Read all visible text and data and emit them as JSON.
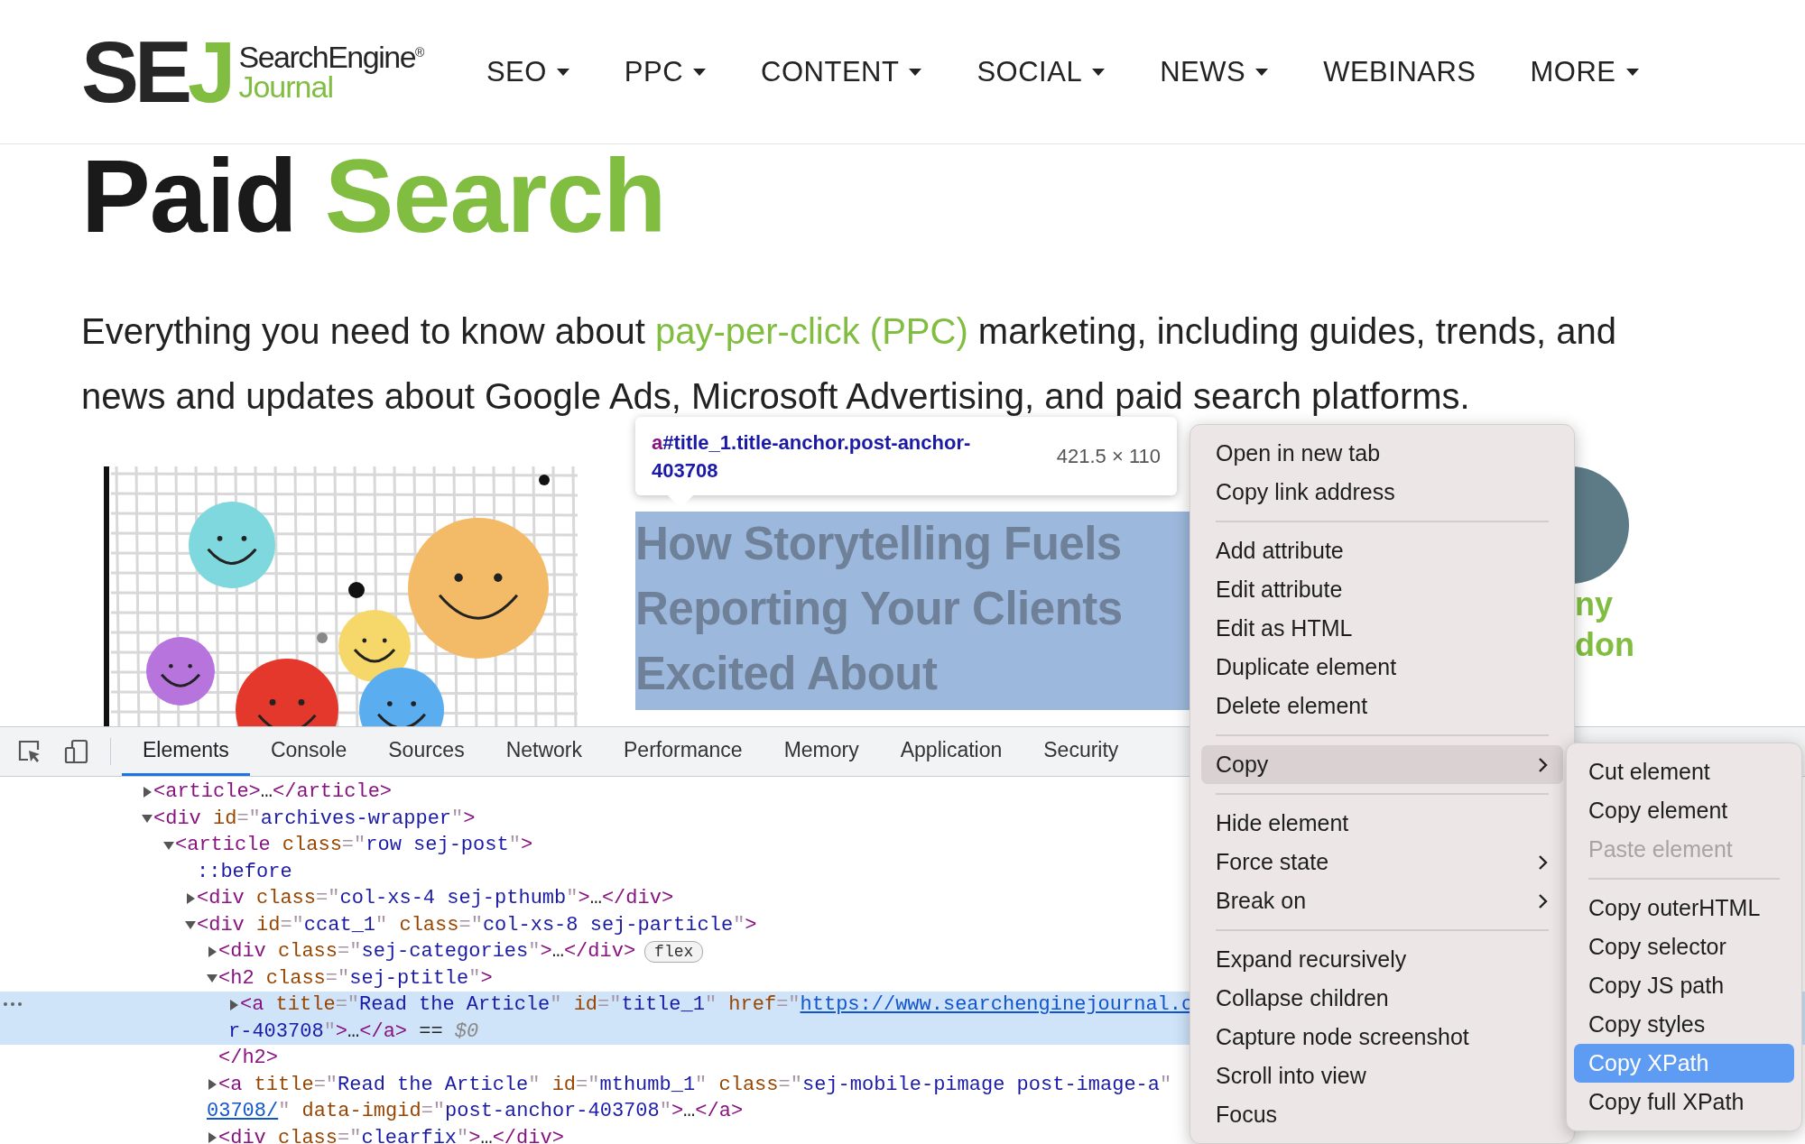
{
  "header": {
    "logo": {
      "mark": "SE",
      "mark_accent": "J",
      "wordmark": "SearchEngine$^{®}$",
      "wordmark_accent": "Journal"
    },
    "nav": [
      {
        "label": "SEO",
        "dropdown": true
      },
      {
        "label": "PPC",
        "dropdown": true
      },
      {
        "label": "CONTENT",
        "dropdown": true
      },
      {
        "label": "SOCIAL",
        "dropdown": true
      },
      {
        "label": "NEWS",
        "dropdown": true
      },
      {
        "label": "WEBINARS",
        "dropdown": false
      },
      {
        "label": "MORE",
        "dropdown": true
      }
    ]
  },
  "hero": {
    "title": "Paid",
    "title_accent": "Search",
    "intro_before": "Everything you need to know about ",
    "intro_link": "pay-per-click (PPC)",
    "intro_after": " marketing, including guides, trends, and news and updates about Google Ads, Microsoft Advertising, and paid search platforms."
  },
  "inspect_tooltip": {
    "tag": "a",
    "selector": "#title_1.title-anchor.post-anchor-403708",
    "size": "421.5 × 110"
  },
  "article": {
    "title_lines": [
      "How Storytelling Fuels",
      "Reporting Your Clients",
      "Excited About"
    ],
    "author_lines": [
      "ny",
      "don"
    ]
  },
  "devtools": {
    "tabs": [
      {
        "label": "Elements",
        "selected": true
      },
      {
        "label": "Console",
        "selected": false
      },
      {
        "label": "Sources",
        "selected": false
      },
      {
        "label": "Network",
        "selected": false
      },
      {
        "label": "Performance",
        "selected": false
      },
      {
        "label": "Memory",
        "selected": false
      },
      {
        "label": "Application",
        "selected": false
      },
      {
        "label": "Security",
        "selected": false
      }
    ],
    "tree": [
      {
        "kind": "element",
        "expanded": false,
        "selected": false,
        "lines": [
          [
            {
              "kind": "tag",
              "text": "<article>"
            },
            {
              "kind": "text",
              "text": "…"
            },
            {
              "kind": "tag",
              "text": "</article>"
            }
          ]
        ]
      },
      {
        "kind": "element",
        "expanded": true,
        "selected": false,
        "lines": [
          [
            {
              "kind": "tag",
              "text": "<div"
            },
            {
              "kind": "attr",
              "text": " id"
            },
            {
              "kind": "punct",
              "text": "=\""
            },
            {
              "kind": "value",
              "text": "archives-wrapper"
            },
            {
              "kind": "punct",
              "text": "\""
            },
            {
              "kind": "tag",
              "text": ">"
            }
          ]
        ],
        "children": [
          {
            "kind": "element",
            "expanded": true,
            "selected": false,
            "lines": [
              [
                {
                  "kind": "tag",
                  "text": "<article"
                },
                {
                  "kind": "attr",
                  "text": " class"
                },
                {
                  "kind": "punct",
                  "text": "=\""
                },
                {
                  "kind": "value",
                  "text": "row sej-post"
                },
                {
                  "kind": "punct",
                  "text": "\""
                },
                {
                  "kind": "tag",
                  "text": ">"
                }
              ]
            ],
            "children": [
              {
                "kind": "pseudo",
                "selected": false,
                "lines": [
                  [
                    {
                      "kind": "pseudo",
                      "text": "::before"
                    }
                  ]
                ]
              },
              {
                "kind": "element",
                "expanded": false,
                "selected": false,
                "lines": [
                  [
                    {
                      "kind": "tag",
                      "text": "<div"
                    },
                    {
                      "kind": "attr",
                      "text": " class"
                    },
                    {
                      "kind": "punct",
                      "text": "=\""
                    },
                    {
                      "kind": "value",
                      "text": "col-xs-4 sej-pthumb"
                    },
                    {
                      "kind": "punct",
                      "text": "\""
                    },
                    {
                      "kind": "tag",
                      "text": ">"
                    },
                    {
                      "kind": "text",
                      "text": "…"
                    },
                    {
                      "kind": "tag",
                      "text": "</div>"
                    }
                  ]
                ]
              },
              {
                "kind": "element",
                "expanded": true,
                "selected": false,
                "lines": [
                  [
                    {
                      "kind": "tag",
                      "text": "<div"
                    },
                    {
                      "kind": "attr",
                      "text": " id"
                    },
                    {
                      "kind": "punct",
                      "text": "=\""
                    },
                    {
                      "kind": "value",
                      "text": "ccat_1"
                    },
                    {
                      "kind": "punct",
                      "text": "\""
                    },
                    {
                      "kind": "attr",
                      "text": " class"
                    },
                    {
                      "kind": "punct",
                      "text": "=\""
                    },
                    {
                      "kind": "value",
                      "text": "col-xs-8 sej-particle"
                    },
                    {
                      "kind": "punct",
                      "text": "\""
                    },
                    {
                      "kind": "tag",
                      "text": ">"
                    }
                  ]
                ],
                "children": [
                  {
                    "kind": "element",
                    "expanded": false,
                    "selected": false,
                    "lines": [
                      [
                        {
                          "kind": "tag",
                          "text": "<div"
                        },
                        {
                          "kind": "attr",
                          "text": " class"
                        },
                        {
                          "kind": "punct",
                          "text": "=\""
                        },
                        {
                          "kind": "value",
                          "text": "sej-categories"
                        },
                        {
                          "kind": "punct",
                          "text": "\""
                        },
                        {
                          "kind": "tag",
                          "text": ">"
                        },
                        {
                          "kind": "text",
                          "text": "…"
                        },
                        {
                          "kind": "tag",
                          "text": "</div>"
                        },
                        {
                          "kind": "badge",
                          "text": "flex"
                        }
                      ]
                    ]
                  },
                  {
                    "kind": "element",
                    "expanded": true,
                    "selected": false,
                    "lines": [
                      [
                        {
                          "kind": "tag",
                          "text": "<h2"
                        },
                        {
                          "kind": "attr",
                          "text": " class"
                        },
                        {
                          "kind": "punct",
                          "text": "=\""
                        },
                        {
                          "kind": "value",
                          "text": "sej-ptitle"
                        },
                        {
                          "kind": "punct",
                          "text": "\""
                        },
                        {
                          "kind": "tag",
                          "text": ">"
                        }
                      ]
                    ],
                    "closing": [
                      {
                        "kind": "tag",
                        "text": "</h2>"
                      }
                    ],
                    "children": [
                      {
                        "kind": "element",
                        "expanded": false,
                        "selected": true,
                        "lines": [
                          [
                            {
                              "kind": "tag",
                              "text": "<a"
                            },
                            {
                              "kind": "attr",
                              "text": " title"
                            },
                            {
                              "kind": "punct",
                              "text": "=\""
                            },
                            {
                              "kind": "value",
                              "text": "Read the Article"
                            },
                            {
                              "kind": "punct",
                              "text": "\""
                            },
                            {
                              "kind": "attr",
                              "text": " id"
                            },
                            {
                              "kind": "punct",
                              "text": "=\""
                            },
                            {
                              "kind": "value",
                              "text": "title_1"
                            },
                            {
                              "kind": "punct",
                              "text": "\""
                            },
                            {
                              "kind": "attr",
                              "text": " href"
                            },
                            {
                              "kind": "punct",
                              "text": "=\""
                            },
                            {
                              "kind": "link",
                              "text": "https://www.searchenginejournal.c"
                            }
                          ],
                          [
                            {
                              "kind": "value",
                              "text": "r-403708"
                            },
                            {
                              "kind": "punct",
                              "text": "\""
                            },
                            {
                              "kind": "tag",
                              "text": ">"
                            },
                            {
                              "kind": "text",
                              "text": "…"
                            },
                            {
                              "kind": "tag",
                              "text": "</a>"
                            },
                            {
                              "kind": "text",
                              "text": " == "
                            },
                            {
                              "kind": "var",
                              "text": "$0"
                            }
                          ]
                        ]
                      }
                    ]
                  },
                  {
                    "kind": "element",
                    "expanded": false,
                    "selected": false,
                    "lines": [
                      [
                        {
                          "kind": "tag",
                          "text": "<a"
                        },
                        {
                          "kind": "attr",
                          "text": " title"
                        },
                        {
                          "kind": "punct",
                          "text": "=\""
                        },
                        {
                          "kind": "value",
                          "text": "Read the Article"
                        },
                        {
                          "kind": "punct",
                          "text": "\""
                        },
                        {
                          "kind": "attr",
                          "text": " id"
                        },
                        {
                          "kind": "punct",
                          "text": "=\""
                        },
                        {
                          "kind": "value",
                          "text": "mthumb_1"
                        },
                        {
                          "kind": "punct",
                          "text": "\""
                        },
                        {
                          "kind": "attr",
                          "text": " class"
                        },
                        {
                          "kind": "punct",
                          "text": "=\""
                        },
                        {
                          "kind": "value",
                          "text": "sej-mobile-pimage post-image-a"
                        },
                        {
                          "kind": "punct",
                          "text": "\""
                        }
                      ],
                      [
                        {
                          "kind": "link",
                          "text": "03708/"
                        },
                        {
                          "kind": "punct",
                          "text": "\""
                        },
                        {
                          "kind": "attr",
                          "text": " data-imgid"
                        },
                        {
                          "kind": "punct",
                          "text": "=\""
                        },
                        {
                          "kind": "value",
                          "text": "post-anchor-403708"
                        },
                        {
                          "kind": "punct",
                          "text": "\""
                        },
                        {
                          "kind": "tag",
                          "text": ">"
                        },
                        {
                          "kind": "text",
                          "text": "…"
                        },
                        {
                          "kind": "tag",
                          "text": "</a>"
                        }
                      ]
                    ]
                  },
                  {
                    "kind": "element",
                    "expanded": false,
                    "selected": false,
                    "lines": [
                      [
                        {
                          "kind": "tag",
                          "text": "<div"
                        },
                        {
                          "kind": "attr",
                          "text": " class"
                        },
                        {
                          "kind": "punct",
                          "text": "=\""
                        },
                        {
                          "kind": "value",
                          "text": "clearfix"
                        },
                        {
                          "kind": "punct",
                          "text": "\""
                        },
                        {
                          "kind": "tag",
                          "text": ">"
                        },
                        {
                          "kind": "text",
                          "text": "…"
                        },
                        {
                          "kind": "tag",
                          "text": "</div>"
                        }
                      ]
                    ]
                  }
                ]
              }
            ]
          }
        ]
      }
    ]
  },
  "context_menu": {
    "items": [
      {
        "kind": "item",
        "label": "Open in new tab",
        "submenu": false,
        "selected": false
      },
      {
        "kind": "item",
        "label": "Copy link address",
        "submenu": false,
        "selected": false
      },
      {
        "kind": "separator"
      },
      {
        "kind": "item",
        "label": "Add attribute",
        "submenu": false,
        "selected": false
      },
      {
        "kind": "item",
        "label": "Edit attribute",
        "submenu": false,
        "selected": false
      },
      {
        "kind": "item",
        "label": "Edit as HTML",
        "submenu": false,
        "selected": false
      },
      {
        "kind": "item",
        "label": "Duplicate element",
        "submenu": false,
        "selected": false
      },
      {
        "kind": "item",
        "label": "Delete element",
        "submenu": false,
        "selected": false
      },
      {
        "kind": "separator"
      },
      {
        "kind": "item",
        "label": "Copy",
        "submenu": true,
        "selected": true
      },
      {
        "kind": "separator"
      },
      {
        "kind": "item",
        "label": "Hide element",
        "submenu": false,
        "selected": false
      },
      {
        "kind": "item",
        "label": "Force state",
        "submenu": true,
        "selected": false
      },
      {
        "kind": "item",
        "label": "Break on",
        "submenu": true,
        "selected": false
      },
      {
        "kind": "separator"
      },
      {
        "kind": "item",
        "label": "Expand recursively",
        "submenu": false,
        "selected": false
      },
      {
        "kind": "item",
        "label": "Collapse children",
        "submenu": false,
        "selected": false
      },
      {
        "kind": "item",
        "label": "Capture node screenshot",
        "submenu": false,
        "selected": false
      },
      {
        "kind": "item",
        "label": "Scroll into view",
        "submenu": false,
        "selected": false
      },
      {
        "kind": "item",
        "label": "Focus",
        "submenu": false,
        "selected": false
      }
    ]
  },
  "copy_submenu": {
    "items": [
      {
        "kind": "item",
        "label": "Cut element",
        "disabled": false,
        "selected": false
      },
      {
        "kind": "item",
        "label": "Copy element",
        "disabled": false,
        "selected": false
      },
      {
        "kind": "item",
        "label": "Paste element",
        "disabled": true,
        "selected": false
      },
      {
        "kind": "separator"
      },
      {
        "kind": "item",
        "label": "Copy outerHTML",
        "disabled": false,
        "selected": false
      },
      {
        "kind": "item",
        "label": "Copy selector",
        "disabled": false,
        "selected": false
      },
      {
        "kind": "item",
        "label": "Copy JS path",
        "disabled": false,
        "selected": false
      },
      {
        "kind": "item",
        "label": "Copy styles",
        "disabled": false,
        "selected": false
      },
      {
        "kind": "item",
        "label": "Copy XPath",
        "disabled": false,
        "selected": true
      },
      {
        "kind": "item",
        "label": "Copy full XPath",
        "disabled": false,
        "selected": false
      }
    ]
  }
}
